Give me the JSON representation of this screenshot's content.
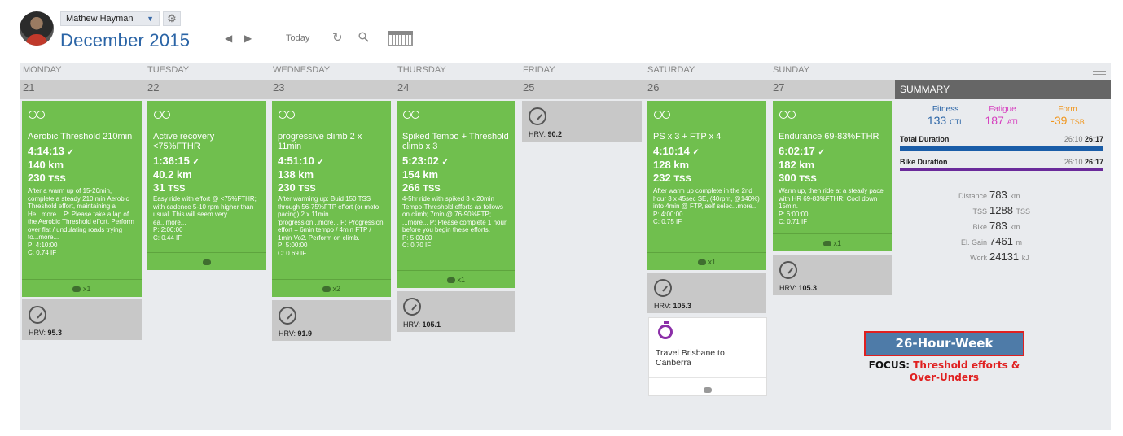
{
  "header": {
    "user_name": "Mathew Hayman",
    "month_title": "December 2015",
    "today_label": "Today"
  },
  "day_names": [
    "MONDAY",
    "TUESDAY",
    "WEDNESDAY",
    "THURSDAY",
    "FRIDAY",
    "SATURDAY",
    "SUNDAY"
  ],
  "dates": [
    "21",
    "22",
    "23",
    "24",
    "25",
    "26",
    "27"
  ],
  "summary": {
    "heading": "SUMMARY",
    "fitness": {
      "label": "Fitness",
      "value": "133",
      "unit": "CTL",
      "color": "#2a64a6"
    },
    "fatigue": {
      "label": "Fatigue",
      "value": "187",
      "unit": "ATL",
      "color": "#d63fbf"
    },
    "form": {
      "label": "Form",
      "value": "-39",
      "unit": "TSB",
      "color": "#f0961e"
    },
    "total_duration": {
      "label": "Total Duration",
      "planned": "26:10",
      "completed": "26:17",
      "bar_color": "#1a5da8"
    },
    "bike_duration": {
      "label": "Bike Duration",
      "planned": "26:10",
      "completed": "26:17",
      "bar_color": "#6a2a9a"
    },
    "stats": [
      {
        "label": "Distance",
        "value": "783",
        "unit": "km"
      },
      {
        "label": "TSS",
        "value": "1288",
        "unit": "TSS"
      },
      {
        "label": "Bike",
        "value": "783",
        "unit": "km"
      },
      {
        "label": "El. Gain",
        "value": "7461",
        "unit": "m"
      },
      {
        "label": "Work",
        "value": "24131",
        "unit": "kJ"
      }
    ]
  },
  "workouts": [
    {
      "day": "monday",
      "title": "Aerobic Threshold 210min",
      "duration": "4:14:13",
      "distance": "140 km",
      "tss": "230",
      "tss_unit": "TSS",
      "description": "After a warm up of 15-20min, complete a steady 210 min Aerobic Threshold effort, maintaining a He...more... P: Please take a lap of the Aerobic Threshold effort. Perform over flat / undulating roads trying to...more...",
      "planned": "P: 4:10:00",
      "if": "C: 0.74 IF",
      "comments": "x1",
      "hrv_label": "HRV:",
      "hrv": "95.3"
    },
    {
      "day": "tuesday",
      "title": "Active recovery <75%FTHR",
      "duration": "1:36:15",
      "distance": "40.2 km",
      "tss": "31",
      "tss_unit": "TSS",
      "description": "Easy ride with effort @ <75%FTHR; with cadence 5-10 rpm higher than usual. This will seem very ea...more...",
      "planned": "P: 2:00:00",
      "if": "C: 0.44 IF",
      "comments": ""
    },
    {
      "day": "wednesday",
      "title": "progressive climb 2 x 11min",
      "duration": "4:51:10",
      "distance": "138 km",
      "tss": "230",
      "tss_unit": "TSS",
      "description": "After warming up: Buid 150 TSS through 56-75%FTP effort (or moto pacing) 2 x 11min 'progression...more... P: Progression effort = 6min tempo / 4min FTP / 1min Vo2. Perform on climb.",
      "planned": "P: 5:00:00",
      "if": "C: 0.69 IF",
      "comments": "x2",
      "hrv_label": "HRV:",
      "hrv": "91.9"
    },
    {
      "day": "thursday",
      "title": "Spiked Tempo + Threshold climb x 3",
      "duration": "5:23:02",
      "distance": "154 km",
      "tss": "266",
      "tss_unit": "TSS",
      "description": "4-5hr ride with spiked 3 x 20min Tempo-Threshold efforts as follows on climb; 7min @ 76-90%FTP; ...more... P: Please complete 1 hour before you begin these efforts.",
      "planned": "P: 5:00:00",
      "if": "C: 0.70 IF",
      "comments": "x1",
      "hrv_label": "HRV:",
      "hrv": "105.1"
    },
    {
      "day": "saturday",
      "title": "PS x 3 + FTP x 4",
      "duration": "4:10:14",
      "distance": "128 km",
      "tss": "232",
      "tss_unit": "TSS",
      "description": "After warm up complete in the 2nd hour 3 x 45sec SE, (40rpm, @140%) into 4min @ FTP, self selec...more...",
      "planned": "P: 4:00:00",
      "if": "C: 0.75 IF",
      "comments": "x1",
      "hrv_label": "HRV:",
      "hrv": "105.3"
    },
    {
      "day": "sunday",
      "title": "Endurance 69-83%FTHR",
      "duration": "6:02:17",
      "distance": "182 km",
      "tss": "300",
      "tss_unit": "TSS",
      "description": "Warm up, then ride at a steady pace with HR 69-83%FTHR; Cool down 15min.",
      "planned": "P: 6:00:00",
      "if": "C: 0.71 IF",
      "comments": "x1",
      "hrv_label": "HRV:",
      "hrv": "105.3"
    }
  ],
  "friday_hrv": {
    "label": "HRV:",
    "value": "90.2"
  },
  "note": {
    "title": "Travel Brisbane to Canberra"
  },
  "week_badge": "26-Hour-Week",
  "focus": {
    "label": "FOCUS:",
    "text": "Threshold efforts & Over-Unders"
  }
}
